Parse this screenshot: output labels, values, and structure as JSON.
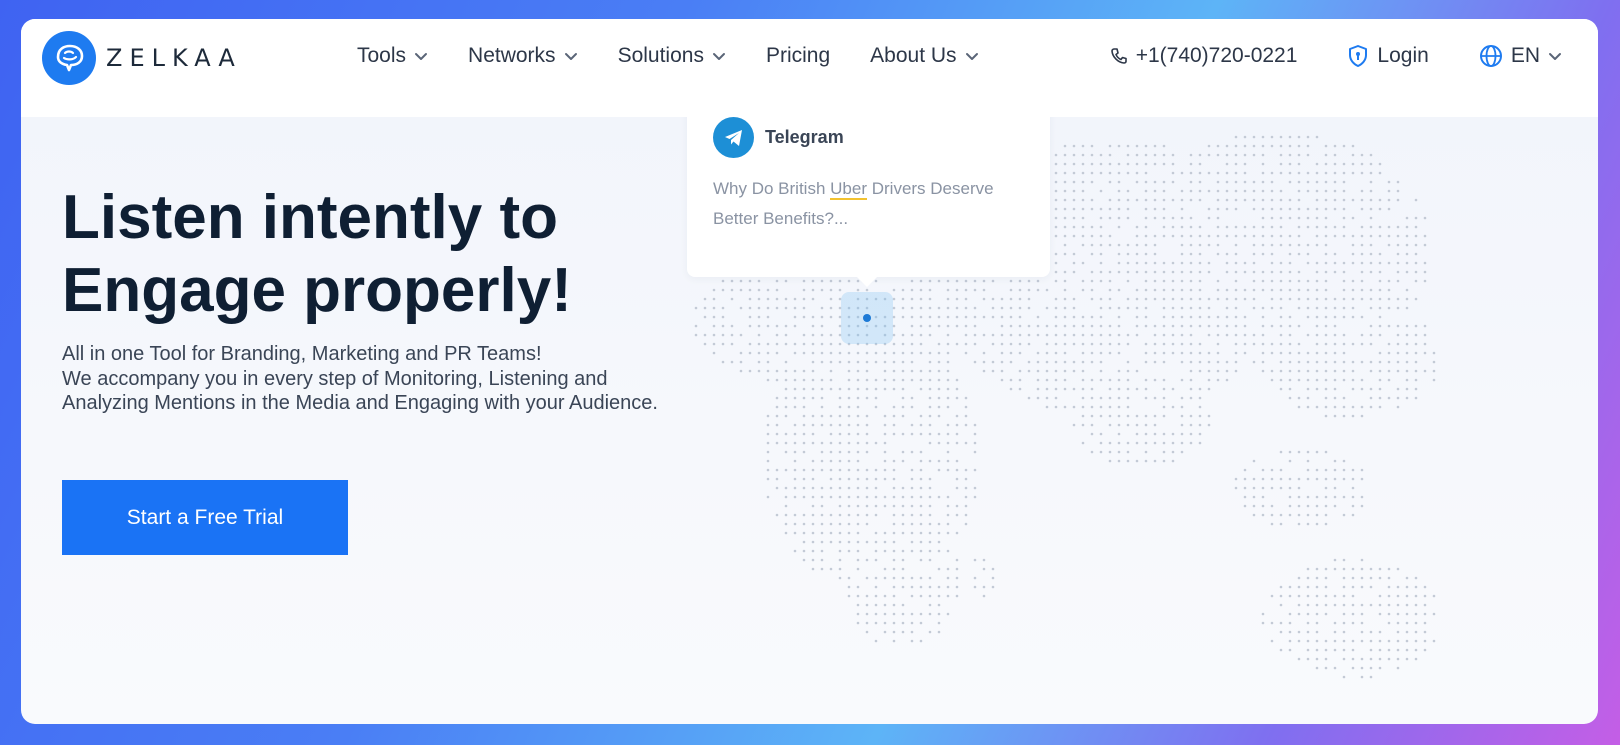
{
  "brand": {
    "name": "ZELKAA",
    "accent": "#1e7bf0"
  },
  "nav": {
    "menu": [
      {
        "label": "Tools",
        "dropdown": true
      },
      {
        "label": "Networks",
        "dropdown": true
      },
      {
        "label": "Solutions",
        "dropdown": true
      },
      {
        "label": "Pricing",
        "dropdown": false
      },
      {
        "label": "About Us",
        "dropdown": true
      }
    ],
    "phone": "+1(740)720-0221",
    "login": "Login",
    "language": "EN"
  },
  "hero": {
    "title_line1": "Listen intently to",
    "title_line2": "Engage properly!",
    "sub_line1": "All in one Tool for Branding, Marketing and PR Teams!",
    "sub_line2": "We accompany you in every step of Monitoring, Listening and Analyzing Mentions in the Media and Engaging with your Audience.",
    "cta": "Start a Free Trial",
    "cta_color": "#1a73f5"
  },
  "mention": {
    "network": "Telegram",
    "text_before": "Why Do British ",
    "highlight": "Uber",
    "text_after": " Drivers Deserve Better Benefits?...",
    "icon": "telegram-icon"
  }
}
